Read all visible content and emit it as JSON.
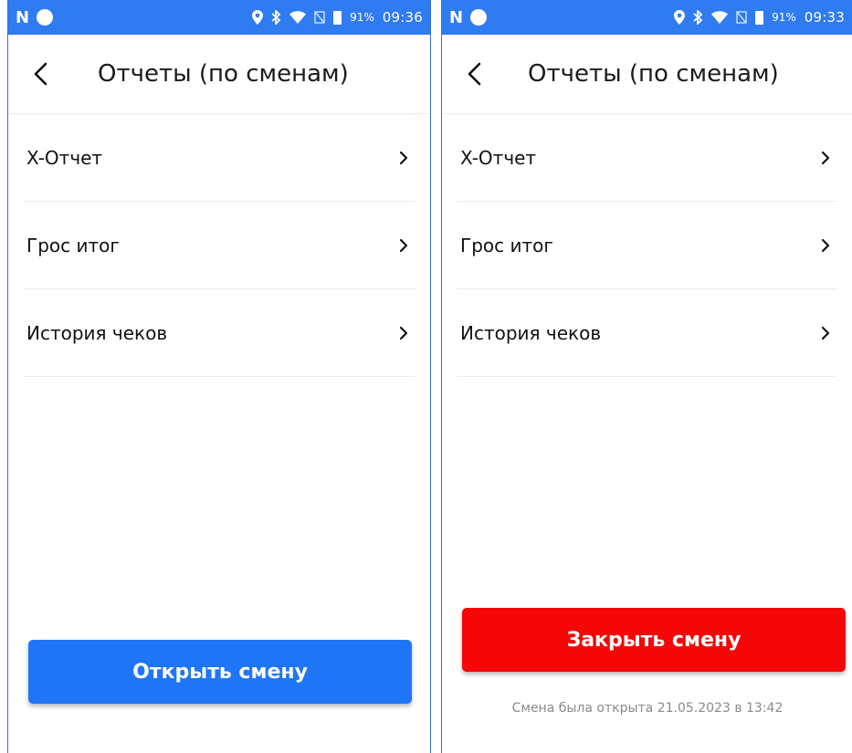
{
  "left": {
    "status": {
      "battery": "91%",
      "time": "09:36"
    },
    "header": {
      "title": "Отчеты (по сменам)"
    },
    "menu": [
      {
        "label": "X-Отчет"
      },
      {
        "label": "Грос итог"
      },
      {
        "label": "История чеков"
      }
    ],
    "action_button": {
      "label": "Открыть смену"
    }
  },
  "right": {
    "status": {
      "battery": "91%",
      "time": "09:33"
    },
    "header": {
      "title": "Отчеты (по сменам)"
    },
    "menu": [
      {
        "label": "X-Отчет"
      },
      {
        "label": "Грос итог"
      },
      {
        "label": "История чеков"
      }
    ],
    "action_button": {
      "label": "Закрыть смену"
    },
    "shift_caption": "Смена была открыта 21.05.2023 в 13:42"
  },
  "colors": {
    "status_bar": "#2f7bf0",
    "open_button": "#1e76f7",
    "close_button": "#f50707"
  },
  "icons": [
    "n-icon",
    "location-icon",
    "bluetooth-icon",
    "wifi-icon",
    "no-sim-icon",
    "battery-icon",
    "back-arrow-icon",
    "chevron-right-icon"
  ]
}
